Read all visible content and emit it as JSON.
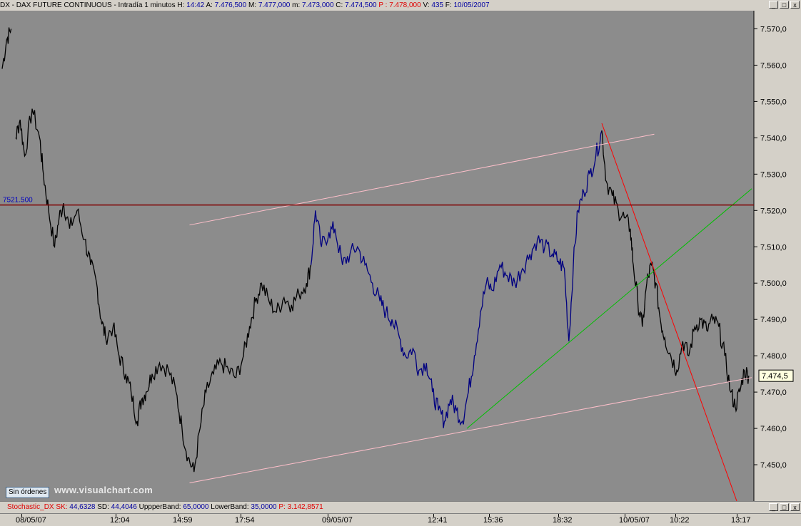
{
  "window": {
    "title_prefix": "DX - DAX FUTURE CONTINUOUS - Intradía 1 minutos",
    "h_label": "H:",
    "h_value": "14:42",
    "a_label": "A:",
    "a_value": "7.476,500",
    "m_label": "M:",
    "m_value": "7.477,000",
    "mi_label": "m:",
    "mi_value": "7.473,000",
    "c_label": "C:",
    "c_value": "7.474,500",
    "p_label": "P :",
    "p_value": "7.478,000",
    "v_label": "V:",
    "v_value": "435",
    "f_label": "F:",
    "f_value": "10/05/2007",
    "buttons": {
      "minimize": "_",
      "restore": "□",
      "close": "x"
    }
  },
  "indicator_bar": {
    "name": "Stochastic_DX",
    "sk_label": "SK:",
    "sk_value": "44,6328",
    "sd_label": "SD:",
    "sd_value": "44,4046",
    "upper_label": "UppperBand:",
    "upper_value": "65,0000",
    "lower_label": "LowerBand:",
    "lower_value": "35,0000",
    "p_label": "P:",
    "p_value": "3.142,8571"
  },
  "orders_button": "Sin órdenes",
  "watermark": "www.visualchart.com",
  "colors": {
    "plot_bg": "#8c8c8c",
    "price_black": "#000000",
    "price_blue": "#000080",
    "channel_pink": "#ffc0cb",
    "support_line": "#800000",
    "trend_green": "#00c000",
    "trend_red": "#ff0000"
  },
  "chart_data": {
    "type": "line",
    "title": "DX - DAX FUTURE CONTINUOUS - Intradía 1 minutos",
    "y_axis": {
      "min": 7440,
      "max": 7575,
      "ticks": [
        "7.450,0",
        "7.460,0",
        "7.470,0",
        "7.480,0",
        "7.490,0",
        "7.500,0",
        "7.510,0",
        "7.520,0",
        "7.530,0",
        "7.540,0",
        "7.550,0",
        "7.560,0",
        "7.570,0"
      ],
      "position": "right"
    },
    "x_ticks": [
      "08/05/07",
      "12:04",
      "14:59",
      "17:54",
      "09/05/07",
      "12:41",
      "15:36",
      "18:32",
      "10/05/07",
      "10:22",
      "13:17"
    ],
    "last_price_label": "7.474,5",
    "last_price": 7474.5,
    "horizontal_line": {
      "value": 7521.5,
      "label": "7521.500"
    },
    "series": [
      {
        "color": "black",
        "points": [
          [
            0,
            7559
          ],
          [
            0.006,
            7567
          ],
          [
            0.012,
            7570
          ]
        ]
      },
      {
        "color": "black",
        "points": [
          [
            0.018,
            7540
          ],
          [
            0.024,
            7545
          ],
          [
            0.03,
            7535
          ],
          [
            0.04,
            7548
          ],
          [
            0.05,
            7540
          ],
          [
            0.055,
            7530
          ],
          [
            0.062,
            7520
          ],
          [
            0.07,
            7510
          ],
          [
            0.076,
            7518
          ],
          [
            0.082,
            7522
          ],
          [
            0.09,
            7515
          ],
          [
            0.1,
            7520
          ],
          [
            0.11,
            7512
          ],
          [
            0.118,
            7505
          ],
          [
            0.126,
            7500
          ],
          [
            0.132,
            7490
          ],
          [
            0.138,
            7485
          ],
          [
            0.148,
            7488
          ],
          [
            0.156,
            7480
          ],
          [
            0.165,
            7475
          ],
          [
            0.172,
            7470
          ],
          [
            0.18,
            7462
          ],
          [
            0.186,
            7468
          ],
          [
            0.192,
            7470
          ],
          [
            0.2,
            7475
          ],
          [
            0.21,
            7478
          ],
          [
            0.222,
            7476
          ],
          [
            0.232,
            7470
          ],
          [
            0.24,
            7460
          ],
          [
            0.248,
            7452
          ],
          [
            0.256,
            7448
          ],
          [
            0.264,
            7460
          ],
          [
            0.272,
            7470
          ],
          [
            0.282,
            7475
          ],
          [
            0.292,
            7478
          ],
          [
            0.302,
            7476
          ],
          [
            0.312,
            7474
          ],
          [
            0.322,
            7480
          ],
          [
            0.33,
            7488
          ],
          [
            0.338,
            7495
          ],
          [
            0.346,
            7500
          ],
          [
            0.356,
            7495
          ],
          [
            0.366,
            7492
          ],
          [
            0.376,
            7496
          ],
          [
            0.386,
            7494
          ],
          [
            0.396,
            7497
          ],
          [
            0.406,
            7500
          ],
          [
            0.412,
            7505
          ]
        ]
      },
      {
        "color": "blue",
        "points": [
          [
            0.412,
            7505
          ],
          [
            0.418,
            7520
          ],
          [
            0.426,
            7510
          ],
          [
            0.436,
            7514
          ],
          [
            0.444,
            7515
          ],
          [
            0.454,
            7505
          ],
          [
            0.464,
            7508
          ],
          [
            0.474,
            7510
          ],
          [
            0.484,
            7505
          ],
          [
            0.494,
            7500
          ],
          [
            0.504,
            7495
          ],
          [
            0.512,
            7492
          ],
          [
            0.52,
            7490
          ],
          [
            0.53,
            7485
          ],
          [
            0.538,
            7480
          ],
          [
            0.548,
            7482
          ],
          [
            0.556,
            7476
          ],
          [
            0.566,
            7478
          ],
          [
            0.574,
            7470
          ],
          [
            0.582,
            7465
          ],
          [
            0.59,
            7462
          ],
          [
            0.598,
            7468
          ],
          [
            0.606,
            7465
          ],
          [
            0.614,
            7462
          ],
          [
            0.622,
            7470
          ],
          [
            0.63,
            7480
          ],
          [
            0.638,
            7492
          ],
          [
            0.646,
            7500
          ],
          [
            0.654,
            7498
          ],
          [
            0.664,
            7505
          ],
          [
            0.674,
            7502
          ],
          [
            0.684,
            7500
          ],
          [
            0.694,
            7504
          ],
          [
            0.704,
            7508
          ],
          [
            0.714,
            7512
          ],
          [
            0.724,
            7510
          ],
          [
            0.734,
            7508
          ],
          [
            0.742,
            7506
          ],
          [
            0.75,
            7504
          ],
          [
            0.756,
            7484
          ],
          [
            0.762,
            7505
          ],
          [
            0.768,
            7520
          ],
          [
            0.776,
            7525
          ],
          [
            0.784,
            7530
          ],
          [
            0.792,
            7535
          ],
          [
            0.8,
            7542
          ]
        ]
      },
      {
        "color": "black",
        "points": [
          [
            0.8,
            7542
          ],
          [
            0.806,
            7528
          ],
          [
            0.814,
            7524
          ],
          [
            0.822,
            7520
          ],
          [
            0.83,
            7518
          ],
          [
            0.838,
            7515
          ],
          [
            0.842,
            7505
          ],
          [
            0.848,
            7495
          ],
          [
            0.854,
            7488
          ],
          [
            0.86,
            7500
          ],
          [
            0.866,
            7505
          ],
          [
            0.872,
            7500
          ],
          [
            0.878,
            7490
          ],
          [
            0.884,
            7485
          ],
          [
            0.892,
            7480
          ],
          [
            0.9,
            7476
          ],
          [
            0.908,
            7484
          ],
          [
            0.916,
            7480
          ],
          [
            0.924,
            7488
          ],
          [
            0.932,
            7490
          ],
          [
            0.94,
            7487
          ],
          [
            0.948,
            7490
          ],
          [
            0.956,
            7488
          ],
          [
            0.964,
            7480
          ],
          [
            0.972,
            7470
          ],
          [
            0.978,
            7466
          ],
          [
            0.984,
            7470
          ],
          [
            0.99,
            7476
          ],
          [
            0.996,
            7474.5
          ]
        ]
      }
    ],
    "trendlines": [
      {
        "color": "pink",
        "from": [
          0.25,
          7516
        ],
        "to": [
          0.87,
          7541
        ]
      },
      {
        "color": "pink",
        "from": [
          0.25,
          7445
        ],
        "to": [
          1.0,
          7474
        ]
      },
      {
        "color": "green",
        "from": [
          0.62,
          7460
        ],
        "to": [
          1.0,
          7526
        ]
      },
      {
        "color": "red",
        "from": [
          0.8,
          7544
        ],
        "to": [
          0.98,
          7440
        ]
      }
    ]
  }
}
